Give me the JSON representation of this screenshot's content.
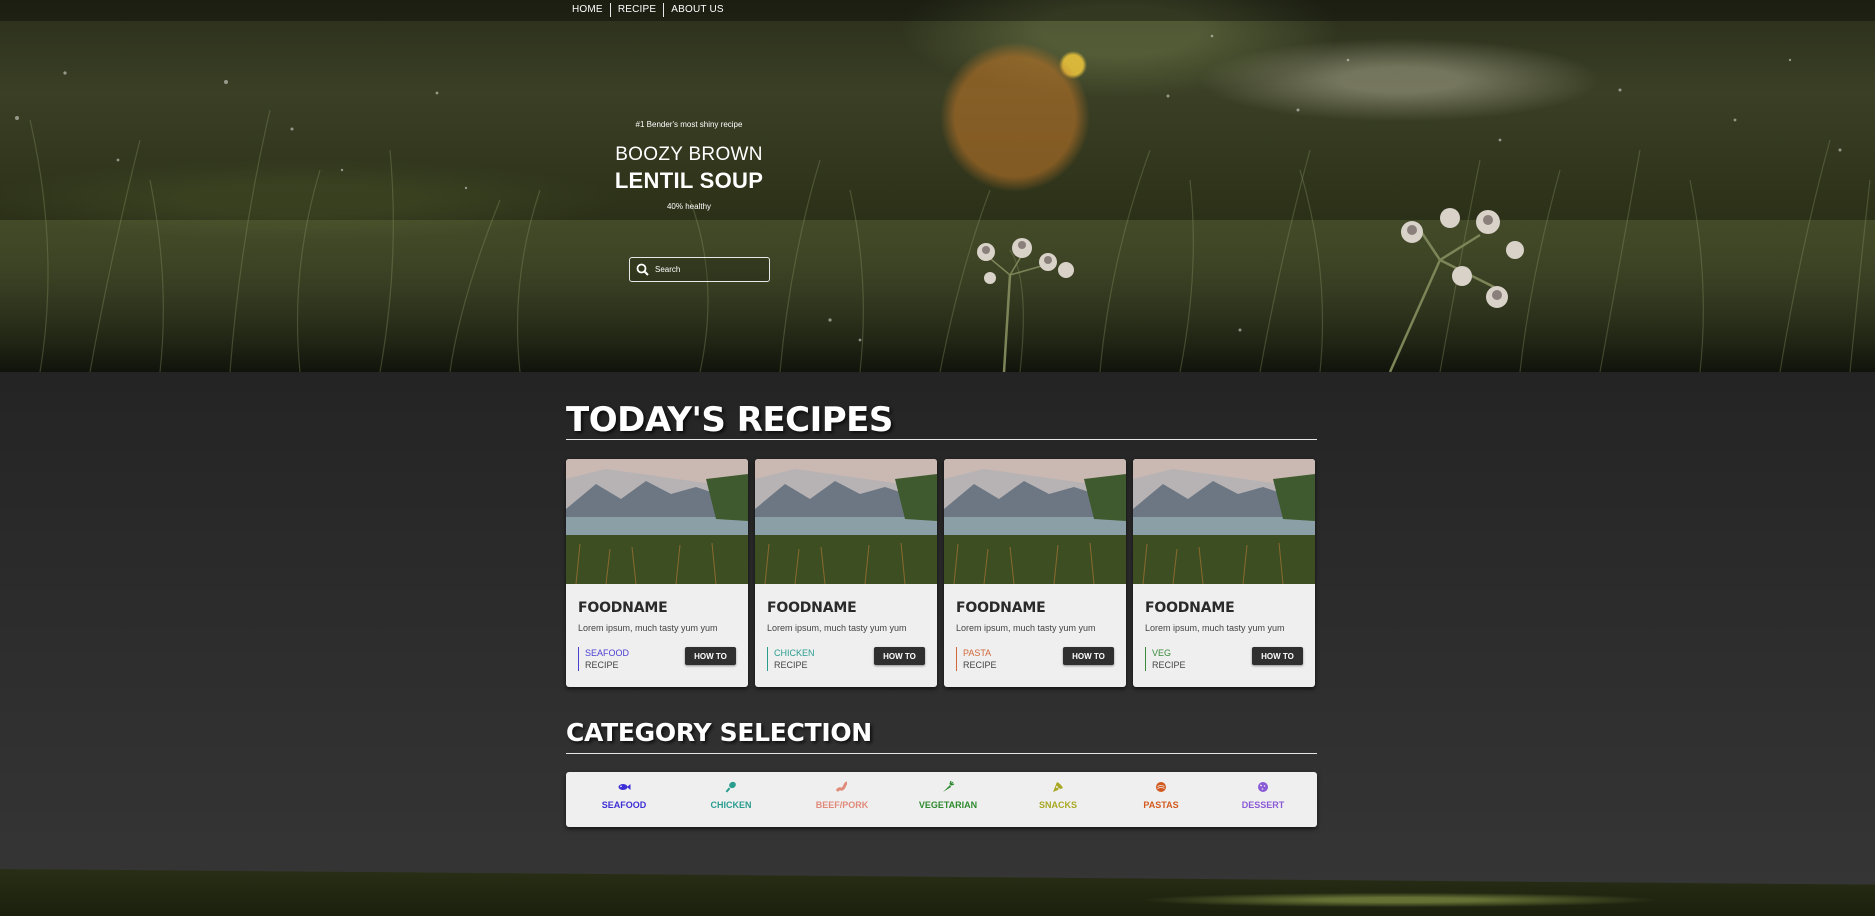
{
  "nav": {
    "items": [
      "HOME",
      "RECIPE",
      "ABOUT US"
    ]
  },
  "hero": {
    "tagline": "#1 Bender's most shiny recipe",
    "title_line1": "BOOZY BROWN",
    "title_line2": "LENTIL SOUP",
    "health": "40% healthy",
    "search_placeholder": "Search"
  },
  "recipes": {
    "title": "TODAY'S RECIPES",
    "cards": [
      {
        "name": "FOODNAME",
        "desc": "Lorem ipsum, much tasty yum yum",
        "category": "SEAFOOD",
        "category_color": "#4a3fd0",
        "type": "RECIPE",
        "button": "HOW TO"
      },
      {
        "name": "FOODNAME",
        "desc": "Lorem ipsum, much tasty yum yum",
        "category": "CHICKEN",
        "category_color": "#2a9d8f",
        "type": "RECIPE",
        "button": "HOW TO"
      },
      {
        "name": "FOODNAME",
        "desc": "Lorem ipsum, much tasty yum yum",
        "category": "PASTA",
        "category_color": "#d0683a",
        "type": "RECIPE",
        "button": "HOW TO"
      },
      {
        "name": "FOODNAME",
        "desc": "Lorem ipsum, much tasty yum yum",
        "category": "VEG",
        "category_color": "#3a8a3a",
        "type": "RECIPE",
        "button": "HOW TO"
      }
    ]
  },
  "categories": {
    "title": "CATEGORY SELECTION",
    "items": [
      {
        "label": "SEAFOOD",
        "color": "#3d2fd6",
        "icon": "fish-icon"
      },
      {
        "label": "CHICKEN",
        "color": "#2a9d8f",
        "icon": "drumstick-icon"
      },
      {
        "label": "BEEF/PORK",
        "color": "#e08a7a",
        "icon": "bacon-icon"
      },
      {
        "label": "VEGETARIAN",
        "color": "#2f8a2f",
        "icon": "carrot-icon"
      },
      {
        "label": "SNACKS",
        "color": "#a8a822",
        "icon": "pizza-slice-icon"
      },
      {
        "label": "PASTAS",
        "color": "#d35a1e",
        "icon": "pasta-bowl-icon"
      },
      {
        "label": "DESSERT",
        "color": "#8a5ad6",
        "icon": "cookie-icon"
      }
    ]
  }
}
